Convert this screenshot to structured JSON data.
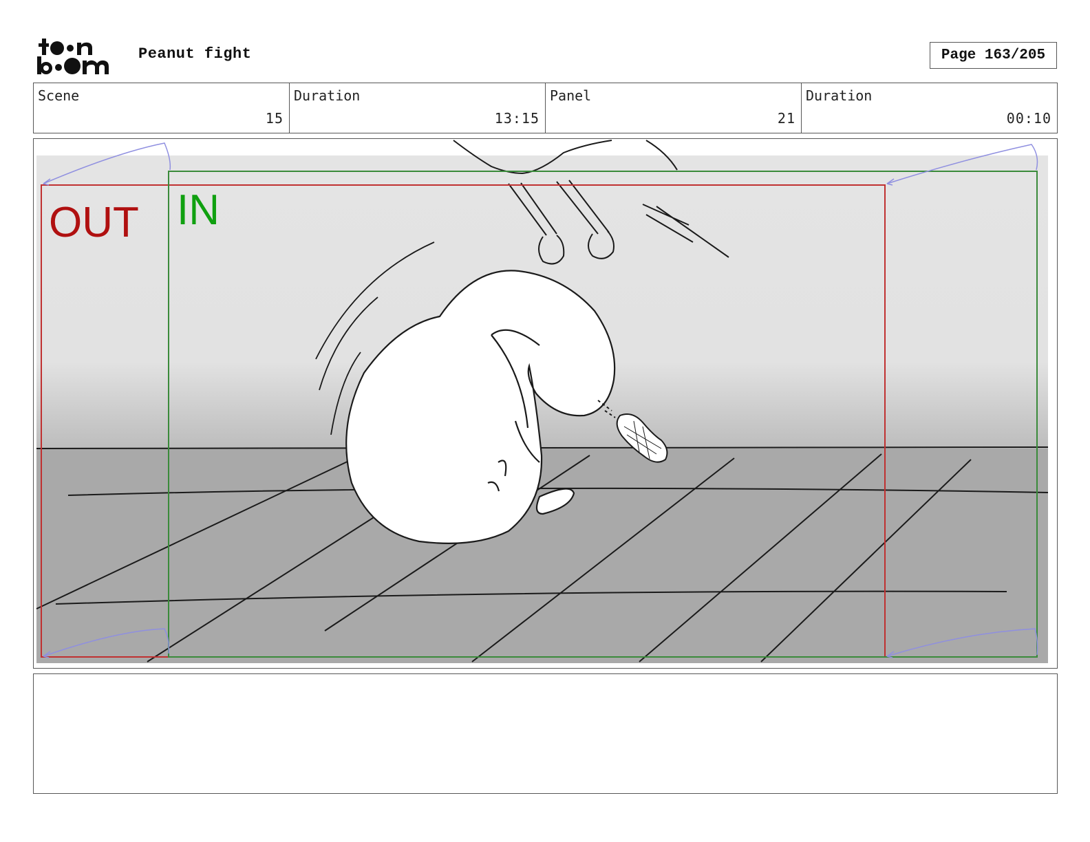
{
  "header": {
    "logo_text": "toon boom",
    "project_title": "Peanut fight",
    "page_label": "Page 163/205"
  },
  "info": {
    "scene_label": "Scene",
    "scene_value": "15",
    "scene_duration_label": "Duration",
    "scene_duration_value": "13:15",
    "panel_label": "Panel",
    "panel_value": "21",
    "panel_duration_label": "Duration",
    "panel_duration_value": "00:10"
  },
  "frame": {
    "out_label": "OUT",
    "in_label": "IN",
    "out_color": "#b01010",
    "in_color": "#10a010",
    "out_frame_color": "#c03030",
    "in_frame_color": "#3a8a3a",
    "floor_color": "#a9a9a9",
    "wall_color": "#e6e6e6"
  },
  "notes": {
    "text": ""
  }
}
